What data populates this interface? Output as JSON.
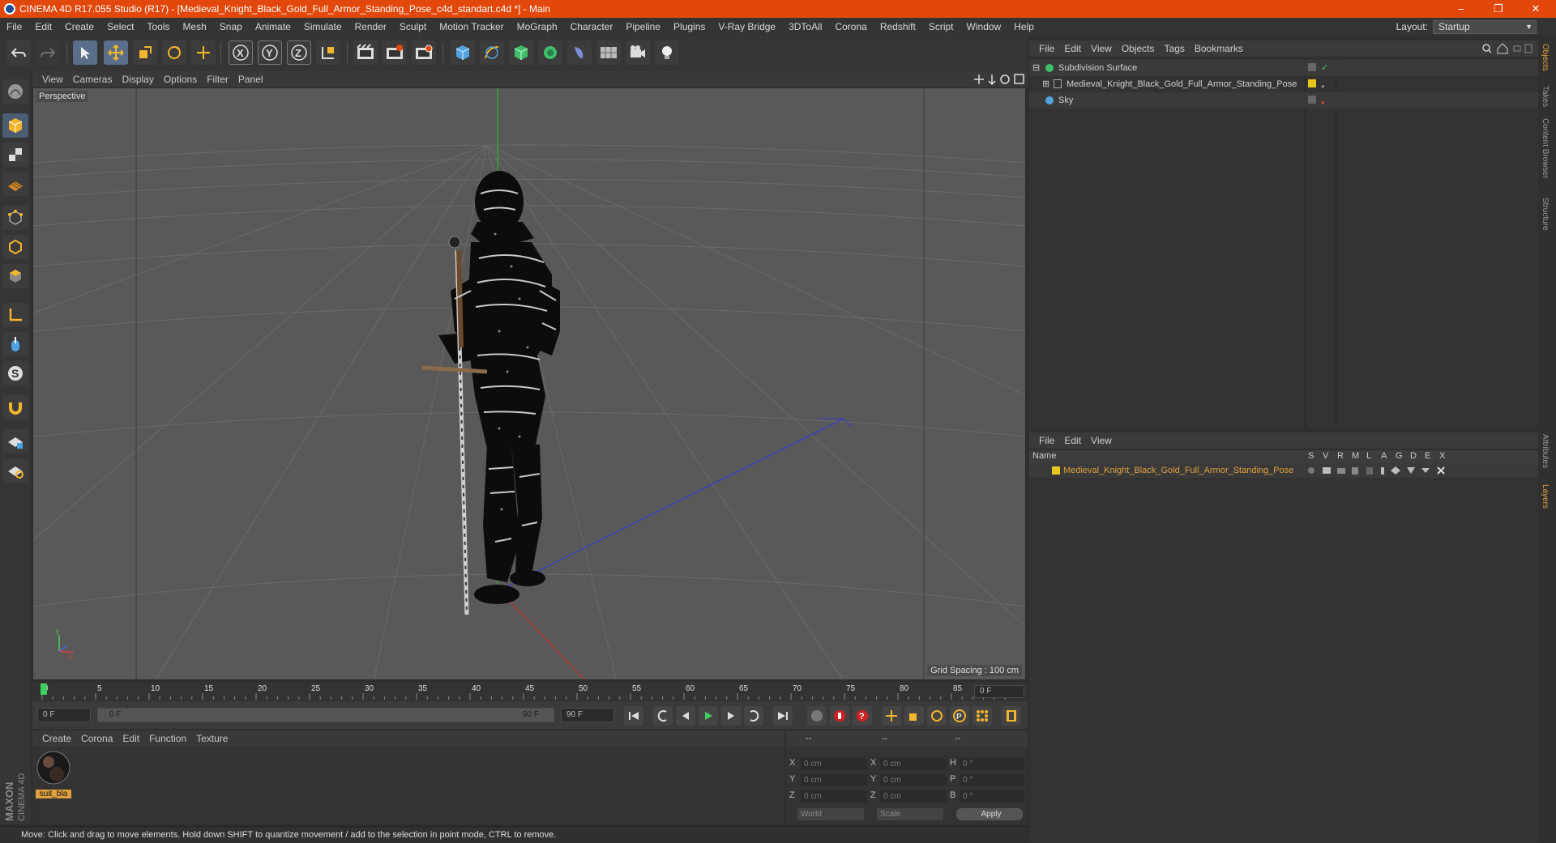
{
  "window": {
    "title": "CINEMA 4D R17.055 Studio (R17) - [Medieval_Knight_Black_Gold_Full_Armor_Standing_Pose_c4d_standart.c4d *] - Main",
    "controls": {
      "minimize": "–",
      "restore": "❐",
      "close": "✕"
    }
  },
  "menubar": {
    "items": [
      "File",
      "Edit",
      "Create",
      "Select",
      "Tools",
      "Mesh",
      "Snap",
      "Animate",
      "Simulate",
      "Render",
      "Sculpt",
      "Motion Tracker",
      "MoGraph",
      "Character",
      "Pipeline",
      "Plugins",
      "V-Ray Bridge",
      "3DToAll",
      "Corona",
      "Redshift",
      "Script",
      "Window",
      "Help"
    ],
    "layout_label": "Layout:",
    "layout_value": "Startup"
  },
  "viewport": {
    "menu": [
      "View",
      "Cameras",
      "Display",
      "Options",
      "Filter",
      "Panel"
    ],
    "camera_label": "Perspective",
    "grid_spacing": "Grid Spacing : 100 cm"
  },
  "timeline": {
    "ticks": [
      "0",
      "5",
      "10",
      "15",
      "20",
      "25",
      "30",
      "35",
      "40",
      "45",
      "50",
      "55",
      "60",
      "65",
      "70",
      "75",
      "80",
      "85",
      "90"
    ],
    "current_frame": "0 F",
    "start_field": "0 F",
    "range_start": "0 F",
    "range_end": "90 F",
    "end_field": "90 F"
  },
  "material_manager": {
    "menu": [
      "Create",
      "Corona",
      "Edit",
      "Function",
      "Texture"
    ],
    "materials": [
      {
        "name": "suit_bla"
      }
    ]
  },
  "coordinates": {
    "header": [
      "--",
      "--",
      "--"
    ],
    "rows": [
      {
        "a": "X",
        "av": "0 cm",
        "b": "X",
        "bv": "0 cm",
        "c": "H",
        "cv": "0 °"
      },
      {
        "a": "Y",
        "av": "0 cm",
        "b": "Y",
        "bv": "0 cm",
        "c": "P",
        "cv": "0 °"
      },
      {
        "a": "Z",
        "av": "0 cm",
        "b": "Z",
        "bv": "0 cm",
        "c": "B",
        "cv": "0 °"
      }
    ],
    "mode1": "World",
    "mode2": "Scale",
    "apply": "Apply"
  },
  "object_manager": {
    "menu": [
      "File",
      "Edit",
      "View",
      "Objects",
      "Tags",
      "Bookmarks"
    ],
    "objects": [
      {
        "name": "Subdivision Surface"
      },
      {
        "name": "Medieval_Knight_Black_Gold_Full_Armor_Standing_Pose"
      },
      {
        "name": "Sky"
      }
    ]
  },
  "layer_manager": {
    "menu": [
      "File",
      "Edit",
      "View"
    ],
    "header_name": "Name",
    "columns": [
      "S",
      "V",
      "R",
      "M",
      "L",
      "A",
      "G",
      "D",
      "E",
      "X"
    ],
    "layers": [
      {
        "name": "Medieval_Knight_Black_Gold_Full_Armor_Standing_Pose",
        "color": "#e8c61c"
      }
    ]
  },
  "right_tabs": [
    "Objects",
    "Takes",
    "Content Browser",
    "Structure",
    "Attributes",
    "Layers"
  ],
  "branding": "MAXON CINEMA 4D",
  "status": "Move: Click and drag to move elements. Hold down SHIFT to quantize movement / add to the selection in point mode, CTRL to remove.",
  "colors": {
    "titlebar": "#e2470b",
    "accent_orange": "#e0a040",
    "layer_yellow": "#e8c61c"
  }
}
